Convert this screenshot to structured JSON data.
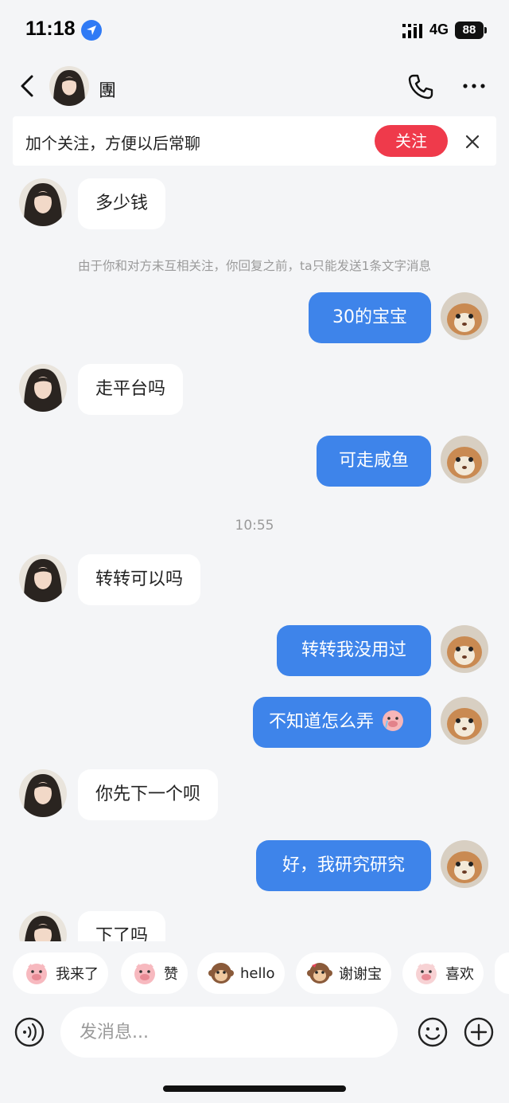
{
  "status_bar": {
    "time": "11:18",
    "network": "4G",
    "battery": "88",
    "location_icon": "location-arrow-icon",
    "signal_icon": "signal-bars-icon"
  },
  "header": {
    "contact_name": "團",
    "back_icon": "chevron-left-icon",
    "call_icon": "phone-icon",
    "more_icon": "more-dots-icon"
  },
  "follow_banner": {
    "text": "加个关注，方便以后常聊",
    "follow_label": "关注",
    "close_icon": "close-icon"
  },
  "messages": [
    {
      "side": "in",
      "text": "多少钱"
    },
    {
      "type": "system",
      "text": "由于你和对方未互相关注，你回复之前，ta只能发送1条文字消息"
    },
    {
      "side": "out",
      "text": "30的宝宝"
    },
    {
      "side": "in",
      "text": "走平台吗"
    },
    {
      "side": "out",
      "text": "可走咸鱼"
    },
    {
      "type": "time",
      "text": "10:55"
    },
    {
      "side": "in",
      "text": "转转可以吗"
    },
    {
      "side": "out",
      "text": "转转我没用过"
    },
    {
      "side": "out",
      "text": "不知道怎么弄"
    },
    {
      "side": "in",
      "text": "你先下一个呗"
    },
    {
      "side": "out",
      "text": "好，我研究研究"
    },
    {
      "side": "in",
      "text": "下了吗"
    }
  ],
  "quick_replies": [
    {
      "label": "我来了",
      "icon": "pig-face-icon"
    },
    {
      "label": "赞",
      "icon": "pig-face-icon"
    },
    {
      "label": "hello",
      "icon": "monkey-face-icon"
    },
    {
      "label": "谢谢宝",
      "icon": "monkey-face-icon"
    },
    {
      "label": "喜欢",
      "icon": "pig-face-icon"
    }
  ],
  "input": {
    "placeholder": "发消息...",
    "voice_icon": "voice-icon",
    "emoji_icon": "smiley-icon",
    "plus_icon": "plus-icon"
  },
  "colors": {
    "background": "#f4f5f7",
    "outgoing_bubble": "#3e84ea",
    "follow_button": "#ef3a4b",
    "incoming_bubble": "#ffffff"
  }
}
